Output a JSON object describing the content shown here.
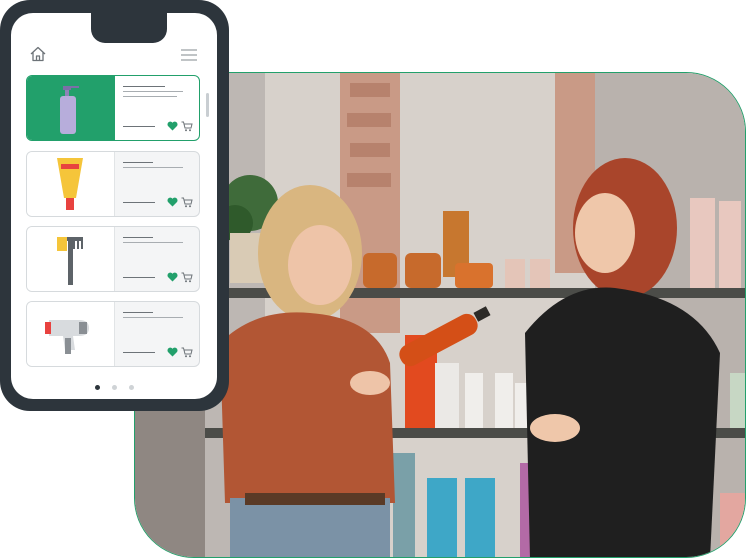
{
  "colors": {
    "accent": "#22a06b",
    "phone_frame": "#2d353c",
    "card_border": "#d6dadd"
  },
  "header": {
    "left_icon": "home-icon",
    "right_icon": "hamburger-menu-icon"
  },
  "products": [
    {
      "icon": "lotion-bottle-icon",
      "selected": true,
      "actions": [
        "heart-icon",
        "cart-icon"
      ]
    },
    {
      "icon": "cream-tube-icon",
      "selected": false,
      "actions": [
        "heart-icon",
        "cart-icon"
      ]
    },
    {
      "icon": "hair-comb-icon",
      "selected": false,
      "actions": [
        "heart-icon",
        "cart-icon"
      ]
    },
    {
      "icon": "hair-dryer-icon",
      "selected": false,
      "actions": [
        "heart-icon",
        "cart-icon"
      ]
    }
  ],
  "pagination": {
    "pages": 3,
    "current": 1
  },
  "photo": {
    "description_icon": "beauty-store-photo"
  }
}
